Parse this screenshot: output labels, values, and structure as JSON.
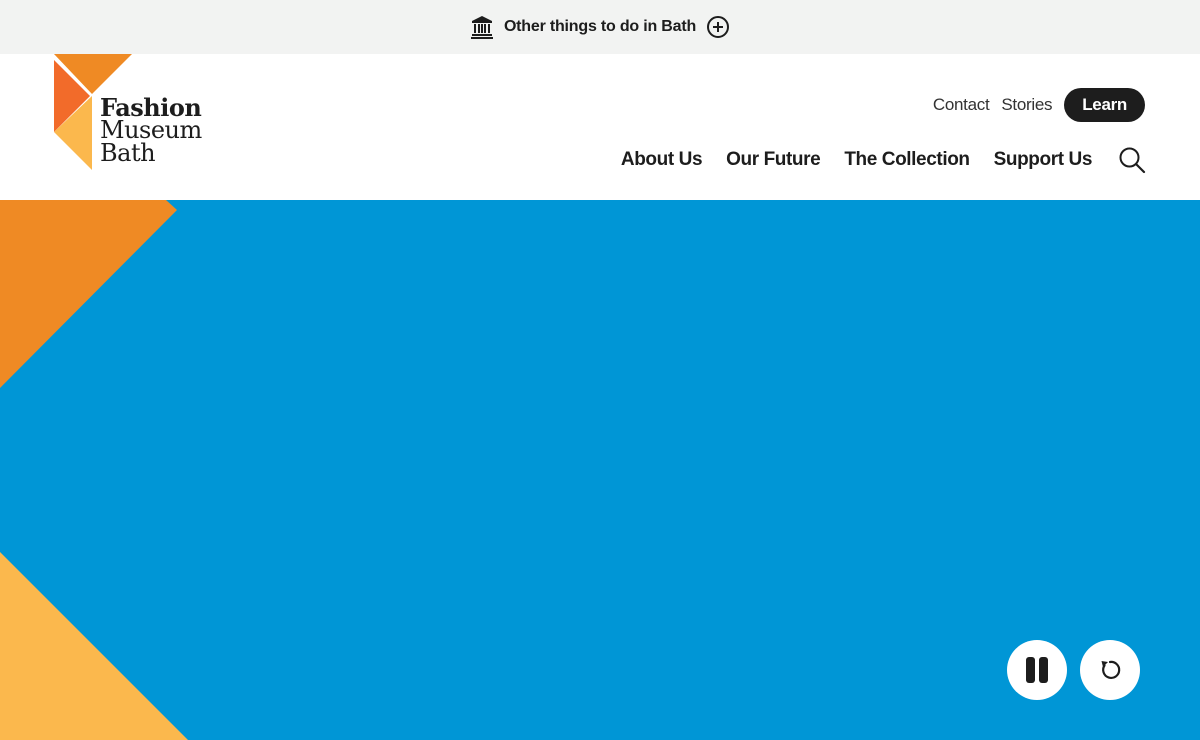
{
  "topbar": {
    "icon": "museum-building-icon",
    "text": "Other things to do in Bath",
    "expand_icon": "plus-circle-icon"
  },
  "logo": {
    "line1": "Fashion",
    "line2": "Museum",
    "line3": "Bath",
    "colors": [
      "#ef8a24",
      "#f26b2a",
      "#fbb84d"
    ]
  },
  "utility_nav": {
    "contact": "Contact",
    "stories": "Stories",
    "learn": "Learn"
  },
  "main_nav": {
    "items": [
      "About Us",
      "Our Future",
      "The Collection",
      "Support Us"
    ],
    "search_icon": "search-icon"
  },
  "hero": {
    "background": "#0096d6",
    "shape_colors": [
      "#ef8a24",
      "#fbb84d"
    ],
    "controls": {
      "pause_icon": "pause-icon",
      "replay_icon": "replay-icon"
    }
  }
}
